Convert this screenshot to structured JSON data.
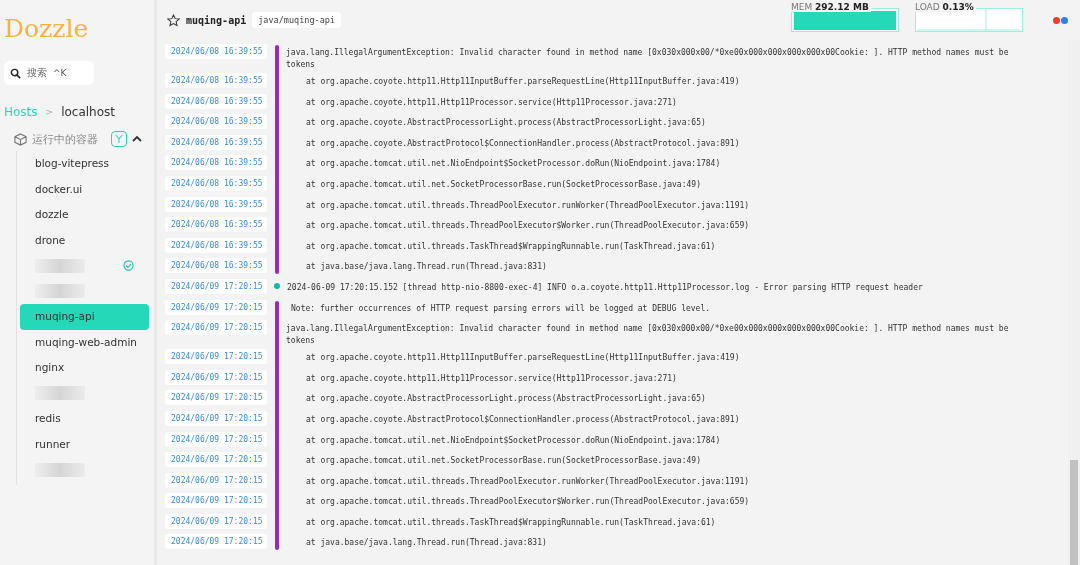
{
  "sidebar": {
    "logo": "Dozzle",
    "search": {
      "placeholder": "搜索",
      "shortcut": "^K"
    },
    "breadcrumb": {
      "root": "Hosts",
      "separator": ">",
      "current": "localhost"
    },
    "section": {
      "title": "运行中的容器",
      "expanded": true
    },
    "containers": [
      {
        "kind": "name",
        "name": "blog-vitepress",
        "selected": false
      },
      {
        "kind": "name",
        "name": "docker.ui",
        "selected": false
      },
      {
        "kind": "name",
        "name": "dozzle",
        "selected": false
      },
      {
        "kind": "name",
        "name": "drone",
        "selected": false
      },
      {
        "kind": "redacted",
        "healthy": true,
        "selected": false
      },
      {
        "kind": "redacted",
        "healthy": false,
        "selected": false
      },
      {
        "kind": "name",
        "name": "muqing-api",
        "selected": true
      },
      {
        "kind": "name",
        "name": "muqing-web-admin",
        "selected": false
      },
      {
        "kind": "name",
        "name": "nginx",
        "selected": false
      },
      {
        "kind": "redacted",
        "healthy": false,
        "selected": false
      },
      {
        "kind": "name",
        "name": "redis",
        "selected": false
      },
      {
        "kind": "name",
        "name": "runner",
        "selected": false
      },
      {
        "kind": "redacted",
        "healthy": false,
        "selected": false
      }
    ]
  },
  "header": {
    "container": "muqing-api",
    "image": "java/muqing-api",
    "favorite": false,
    "mem": {
      "label": "MEM",
      "value": "292.12 MB"
    },
    "load": {
      "label": "LOAD",
      "value": "0.13%"
    },
    "dots": [
      {
        "color": "#f03c2e"
      },
      {
        "color": "#2f80ed"
      }
    ]
  },
  "log_groups": [
    {
      "kind": "stack",
      "rows": [
        {
          "kind": "message",
          "time": "2024/06/08 16:39:55",
          "text": "java.lang.IllegalArgumentException: Invalid character found in method name [0x030x000x00/*0xe00x000x000x000x000x00Cookie: ]. HTTP method names must be tokens"
        },
        {
          "kind": "frame",
          "time": "2024/06/08 16:39:55",
          "text": "at org.apache.coyote.http11.Http11InputBuffer.parseRequestLine(Http11InputBuffer.java:419)"
        },
        {
          "kind": "frame",
          "time": "2024/06/08 16:39:55",
          "text": "at org.apache.coyote.http11.Http11Processor.service(Http11Processor.java:271)"
        },
        {
          "kind": "frame",
          "time": "2024/06/08 16:39:55",
          "text": "at org.apache.coyote.AbstractProcessorLight.process(AbstractProcessorLight.java:65)"
        },
        {
          "kind": "frame",
          "time": "2024/06/08 16:39:55",
          "text": "at org.apache.coyote.AbstractProtocol$ConnectionHandler.process(AbstractProtocol.java:891)"
        },
        {
          "kind": "frame",
          "time": "2024/06/08 16:39:55",
          "text": "at org.apache.tomcat.util.net.NioEndpoint$SocketProcessor.doRun(NioEndpoint.java:1784)"
        },
        {
          "kind": "frame",
          "time": "2024/06/08 16:39:55",
          "text": "at org.apache.tomcat.util.net.SocketProcessorBase.run(SocketProcessorBase.java:49)"
        },
        {
          "kind": "frame",
          "time": "2024/06/08 16:39:55",
          "text": "at org.apache.tomcat.util.threads.ThreadPoolExecutor.runWorker(ThreadPoolExecutor.java:1191)"
        },
        {
          "kind": "frame",
          "time": "2024/06/08 16:39:55",
          "text": "at org.apache.tomcat.util.threads.ThreadPoolExecutor$Worker.run(ThreadPoolExecutor.java:659)"
        },
        {
          "kind": "frame",
          "time": "2024/06/08 16:39:55",
          "text": "at org.apache.tomcat.util.threads.TaskThread$WrappingRunnable.run(TaskThread.java:61)"
        },
        {
          "kind": "frame",
          "time": "2024/06/08 16:39:55",
          "text": "at java.base/java.lang.Thread.run(Thread.java:831)"
        }
      ]
    },
    {
      "kind": "single",
      "rows": [
        {
          "kind": "info",
          "time": "2024/06/09 17:20:15",
          "text": "2024-06-09 17:20:15.152 [thread http-nio-8800-exec-4] INFO  o.a.coyote.http11.Http11Processor.log - Error parsing HTTP request header"
        }
      ]
    },
    {
      "kind": "stack",
      "rows": [
        {
          "kind": "note",
          "time": "2024/06/09 17:20:15",
          "text": "Note: further occurrences of HTTP request parsing errors will be logged at DEBUG level."
        },
        {
          "kind": "message",
          "time": "2024/06/09 17:20:15",
          "text": "java.lang.IllegalArgumentException: Invalid character found in method name [0x030x000x00/*0xe00x000x000x000x000x00Cookie: ]. HTTP method names must be tokens"
        },
        {
          "kind": "frame",
          "time": "2024/06/09 17:20:15",
          "text": "at org.apache.coyote.http11.Http11InputBuffer.parseRequestLine(Http11InputBuffer.java:419)"
        },
        {
          "kind": "frame",
          "time": "2024/06/09 17:20:15",
          "text": "at org.apache.coyote.http11.Http11Processor.service(Http11Processor.java:271)"
        },
        {
          "kind": "frame",
          "time": "2024/06/09 17:20:15",
          "text": "at org.apache.coyote.AbstractProcessorLight.process(AbstractProcessorLight.java:65)"
        },
        {
          "kind": "frame",
          "time": "2024/06/09 17:20:15",
          "text": "at org.apache.coyote.AbstractProtocol$ConnectionHandler.process(AbstractProtocol.java:891)"
        },
        {
          "kind": "frame",
          "time": "2024/06/09 17:20:15",
          "text": "at org.apache.tomcat.util.net.NioEndpoint$SocketProcessor.doRun(NioEndpoint.java:1784)"
        },
        {
          "kind": "frame",
          "time": "2024/06/09 17:20:15",
          "text": "at org.apache.tomcat.util.net.SocketProcessorBase.run(SocketProcessorBase.java:49)"
        },
        {
          "kind": "frame",
          "time": "2024/06/09 17:20:15",
          "text": "at org.apache.tomcat.util.threads.ThreadPoolExecutor.runWorker(ThreadPoolExecutor.java:1191)"
        },
        {
          "kind": "frame",
          "time": "2024/06/09 17:20:15",
          "text": "at org.apache.tomcat.util.threads.ThreadPoolExecutor$Worker.run(ThreadPoolExecutor.java:659)"
        },
        {
          "kind": "frame",
          "time": "2024/06/09 17:20:15",
          "text": "at org.apache.tomcat.util.threads.TaskThread$WrappingRunnable.run(TaskThread.java:61)"
        },
        {
          "kind": "frame",
          "time": "2024/06/09 17:20:15",
          "text": "at java.base/java.lang.Thread.run(Thread.java:831)"
        }
      ]
    }
  ]
}
